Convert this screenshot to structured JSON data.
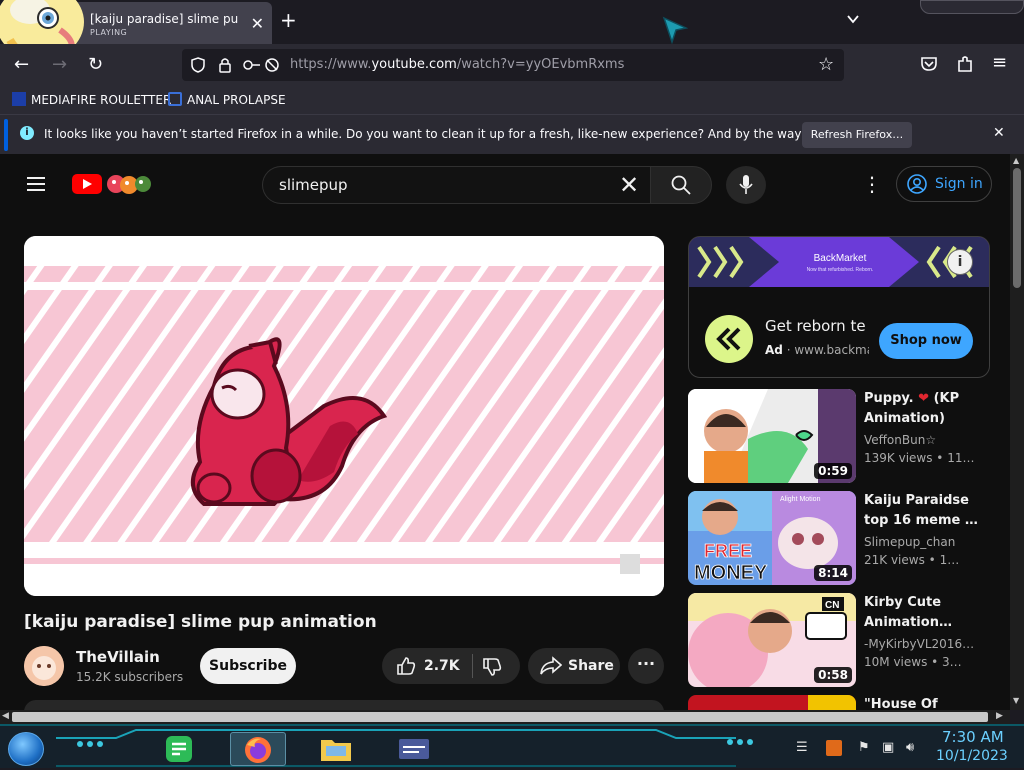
{
  "browser": {
    "tab": {
      "title": "[kaiju paradise] slime pup animation",
      "subtitle": "PLAYING"
    },
    "address_bar": {
      "url_prefix": "https://www.",
      "url_domain": "youtube.com",
      "url_path": "/watch?v=yyOEvbmRxms"
    },
    "bookmarks": [
      {
        "label": "MEDIAFIRE ROULETTER"
      },
      {
        "label": "ANAL PROLAPSE"
      }
    ],
    "notification": {
      "message": "It looks like you haven’t started Firefox in a while. Do you want to clean it up for a fresh, like-new experience? And by the way, welcome back!",
      "button": "Refresh Firefox…"
    }
  },
  "youtube": {
    "search": {
      "value": "slimepup"
    },
    "sign_in_label": "Sign in",
    "video": {
      "title": "[kaiju paradise] slime pup animation",
      "channel": "TheVillain",
      "subscribers": "15.2K subscribers",
      "subscribe_label": "Subscribe",
      "likes": "2.7K",
      "share_label": "Share"
    },
    "ad": {
      "banner_brand": "BackMarket",
      "banner_tagline": "Now that refurbished. Reborn.",
      "headline": "Get reborn tech",
      "badge": "Ad",
      "domain": "www.backmarket.com",
      "cta": "Shop now"
    },
    "recommendations": [
      {
        "title_line1": "Puppy. ",
        "heart": "❤",
        "title_line1b": " (KP",
        "title_line2": "Animation)",
        "channel": "VeffonBun☆",
        "views": "139K views",
        "age": "11…",
        "duration": "0:59"
      },
      {
        "title_line1": "Kaiju Paraidse",
        "title_line2": "top 16 meme …",
        "channel": "Slimepup_chan",
        "views": "21K views",
        "age": "1…",
        "duration": "8:14",
        "thumb_text_1": "FREE",
        "thumb_text_2": "MONEY",
        "thumb_label": "Alight Motion"
      },
      {
        "title_line1": "Kirby Cute",
        "title_line2": "Animation…",
        "channel": "-MyKirbyVL2016…",
        "views": "10M views",
        "age": "3…",
        "duration": "0:58",
        "thumb_badge": "CN"
      },
      {
        "title_line1": "\"House Of"
      }
    ]
  },
  "taskbar": {
    "time": "7:30 AM",
    "date": "10/1/2023"
  },
  "colors": {
    "youtube_red": "#ff0000",
    "link_blue": "#3ea6ff",
    "firefox_dark": "#1c1b22",
    "firefox_toolbar": "#2b2a33",
    "video_pink": "#f7c6d4",
    "slime_red": "#d9254e"
  }
}
